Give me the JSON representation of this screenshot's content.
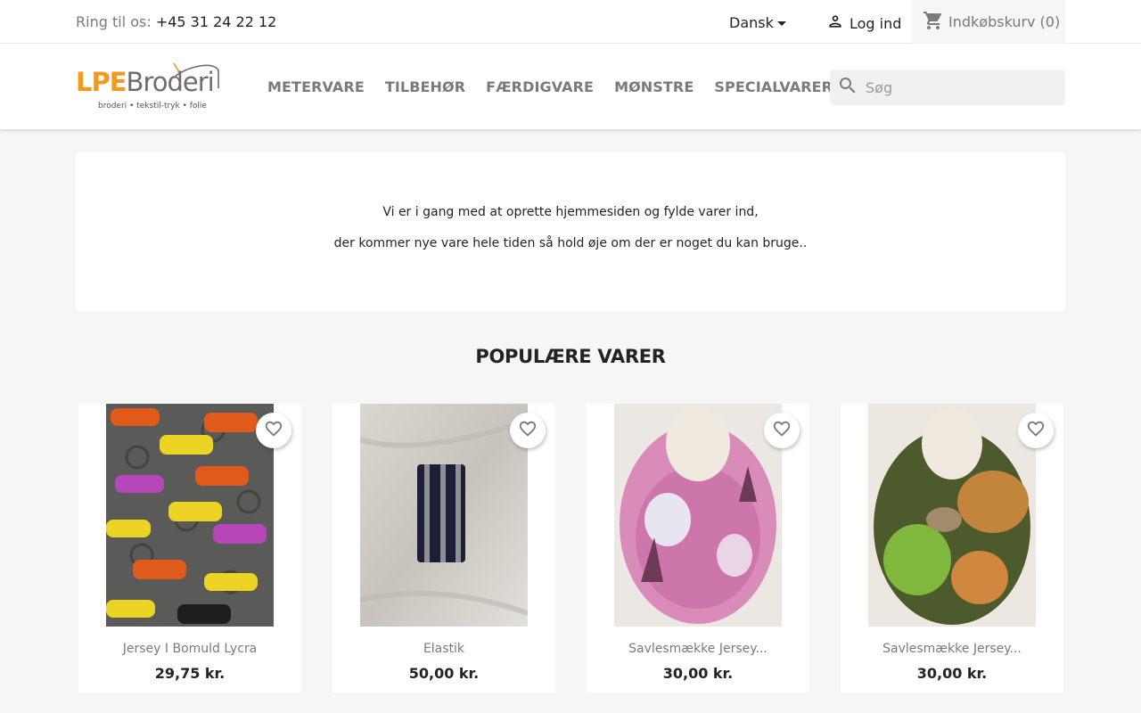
{
  "topbar": {
    "phone_label": "Ring til os:",
    "phone_number": "+45 31 24 22 12",
    "language": "Dansk",
    "login_label": "Log ind",
    "cart_label": "Indkøbskurv",
    "cart_count": "(0)"
  },
  "header": {
    "logo": {
      "brand_accent": "LPE",
      "brand_rest": "Broderi",
      "tagline": "broderi • tekstil-tryk • folie"
    },
    "nav": [
      "METERVARE",
      "TILBEHØR",
      "FÆRDIGVARE",
      "MØNSTRE",
      "SPECIALVARER"
    ],
    "search_placeholder": "Søg"
  },
  "notice": {
    "line1": "Vi er i gang med at oprette hjemmesiden og fylde varer ind,",
    "line2": "der kommer nye vare hele tiden så hold øje om der er noget du kan bruge.."
  },
  "popular": {
    "title": "POPULÆRE VARER",
    "products": [
      {
        "name": "Jersey I Bomuld Lycra",
        "price": "29,75 kr."
      },
      {
        "name": "Elastik",
        "price": "50,00 kr."
      },
      {
        "name": "Savlesmække Jersey...",
        "price": "30,00 kr."
      },
      {
        "name": "Savlesmække Jersey...",
        "price": "30,00 kr."
      }
    ]
  },
  "icons": {
    "login": "person-icon",
    "cart": "shopping-cart-icon",
    "search": "search-icon",
    "favorite": "heart-outline-icon",
    "language": "caret-down-icon"
  },
  "colors": {
    "brand_orange": "#f39a1e",
    "nav_text": "#7a7a7a",
    "page_bg": "#f6f6f6"
  }
}
